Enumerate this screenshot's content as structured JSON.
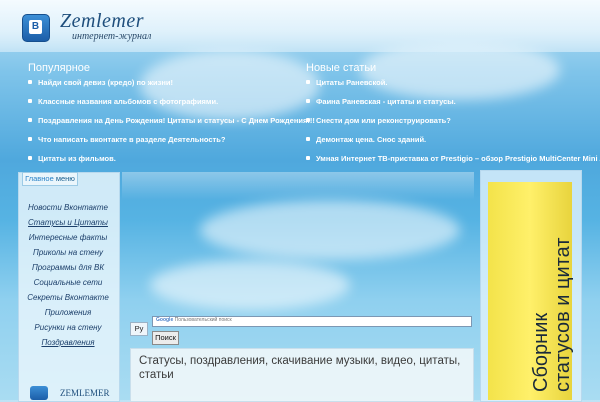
{
  "header": {
    "logo_icon": "В",
    "title": "Zemlemer",
    "subtitle": "интернет-журнал"
  },
  "popular": {
    "heading": "Популярное",
    "items": [
      "Найди свой девиз (кредо) по жизни!",
      "Классные названия альбомов с фотографиями.",
      "Поздравления на День Рождения! Цитаты и статусы - С Днем Рождения!!!",
      "Что написать вконтакте в разделе Деятельность?",
      "Цитаты из фильмов."
    ]
  },
  "new_articles": {
    "heading": "Новые статьи",
    "items": [
      "Цитаты Раневской.",
      "Фаина Раневская - цитаты и статусы.",
      "Снести дом или реконструировать?",
      "Демонтаж цена. Снос зданий.",
      "Умная Интернет ТВ-приставка от Prestigio – обзор Prestigio MultiCenter Mini /"
    ]
  },
  "left_menu": {
    "tab_main": "Главное",
    "tab_rest": " меню",
    "items": [
      "Новости Вконтакте",
      "Статусы и Цитаты",
      "Интересные факты",
      "Приколы на стену",
      "Программы для ВК",
      "Социальные сети",
      "Секреты Вконтакте",
      "Приложения",
      "Рисунки на стену",
      "Поздравления"
    ],
    "bottom_title": "ZEMLEMER"
  },
  "search": {
    "lang": "Ру",
    "google": "Google",
    "placeholder": "Пользовательский поиск",
    "button": "Поиск"
  },
  "content": {
    "heading": "Статусы, поздравления, скачивание музыки, видео, цитаты, статьи"
  },
  "banner": {
    "line1": "Сборник",
    "line2": "статусов и цитат"
  }
}
